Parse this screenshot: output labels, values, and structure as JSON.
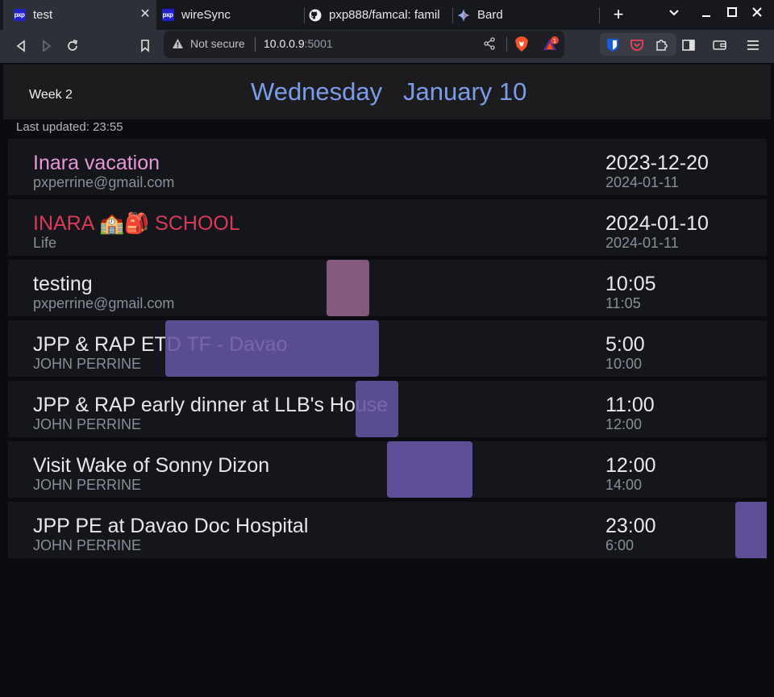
{
  "browser": {
    "tabs": [
      {
        "title": "test",
        "icon": "pp-favicon",
        "active": true
      },
      {
        "title": "wireSync",
        "icon": "pp-favicon",
        "active": false
      },
      {
        "title": "pxp888/famcal: famil",
        "icon": "github-icon",
        "active": false
      },
      {
        "title": "Bard",
        "icon": "bard-sparkle-icon",
        "active": false
      }
    ],
    "favicon_text": "pxp",
    "new_tab_label": "+",
    "address": {
      "security_label": "Not secure",
      "host": "10.0.0.9",
      "port": ":5001"
    },
    "rewards_badge": "1"
  },
  "app": {
    "week_label": "Week 2",
    "day_name": "Wednesday",
    "date_label": "January 10",
    "last_updated": "Last updated: 23:55",
    "events": [
      {
        "title": "Inara vacation",
        "subtitle": "pxperrine@gmail.com",
        "start": "2023-12-20",
        "end": "2024-01-11",
        "title_color": "#e997d8"
      },
      {
        "title": "INARA 🏫🎒 SCHOOL",
        "subtitle": "Life",
        "start": "2024-01-10",
        "end": "2024-01-11",
        "title_color": "#d83a5a"
      },
      {
        "title": "testing",
        "subtitle": "pxperrine@gmail.com",
        "start": "10:05",
        "end": "11:05",
        "title_color": "#e8e8e8"
      },
      {
        "title": "JPP & RAP ETD TF - Davao",
        "subtitle": "JOHN PERRINE",
        "start": "5:00",
        "end": "10:00",
        "title_color": "#e8e8e8"
      },
      {
        "title": "JPP & RAP early dinner at LLB's House",
        "subtitle": "JOHN PERRINE",
        "start": "11:00",
        "end": "12:00",
        "title_color": "#e8e8e8"
      },
      {
        "title": "Visit Wake of Sonny Dizon",
        "subtitle": "JOHN PERRINE",
        "start": "12:00",
        "end": "14:00",
        "title_color": "#e8e8e8"
      },
      {
        "title": "JPP PE at Davao Doc Hospital",
        "subtitle": "JOHN PERRINE",
        "start": "23:00",
        "end": "6:00",
        "title_color": "#e8e8e8"
      }
    ],
    "colors": {
      "accent": "#7b9ce8",
      "timeline_bar": "#5c4d8f",
      "timeline_bar_pink": "#845c80"
    }
  }
}
